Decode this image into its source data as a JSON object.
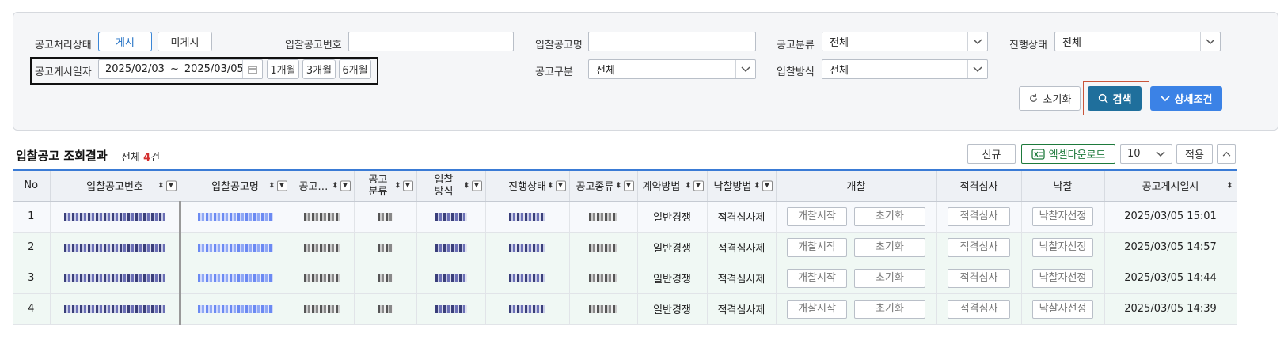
{
  "filters": {
    "status_label": "공고처리상태",
    "status_posted": "게시",
    "status_unposted": "미게시",
    "notice_no_label": "입찰공고번호",
    "notice_name_label": "입찰공고명",
    "category_label": "공고분류",
    "category_value": "전체",
    "progress_label": "진행상태",
    "progress_value": "전체",
    "post_date_label": "공고게시일자",
    "date_from": "2025/02/03",
    "date_sep": "~",
    "date_to": "2025/03/05",
    "range_1m": "1개월",
    "range_3m": "3개월",
    "range_6m": "6개월",
    "notice_type_label": "공고구분",
    "notice_type_value": "전체",
    "bid_method_label": "입찰방식",
    "bid_method_value": "전체",
    "reset_label": "초기화",
    "search_label": "검색",
    "detail_label": "상세조건"
  },
  "results": {
    "title": "입찰공고 조회결과",
    "total_prefix": "전체 ",
    "total_count": "4",
    "total_suffix": "건",
    "new_label": "신규",
    "excel_label": "엑셀다운로드",
    "page_size": "10",
    "apply_label": "적용"
  },
  "table": {
    "headers": {
      "no": "No",
      "notice_no": "입찰공고번호",
      "notice_name": "입찰공고명",
      "notice_trunc": "공고…",
      "cat_1": "공고",
      "cat_2": "분류",
      "bid_1": "입찰",
      "bid_2": "방식",
      "progress": "진행상태",
      "kind": "공고종류",
      "contract": "계약방법",
      "award": "낙찰방법",
      "opening": "개찰",
      "qual": "적격심사",
      "award_sel": "낙찰",
      "posted_at": "공고게시일시"
    },
    "rows": [
      {
        "no": "1",
        "contract": "일반경쟁",
        "award": "적격심사제",
        "open_start": "개찰시작",
        "reset": "초기화",
        "qual": "적격심사",
        "award_sel": "낙찰자선정",
        "posted_at": "2025/03/05 15:01"
      },
      {
        "no": "2",
        "contract": "일반경쟁",
        "award": "적격심사제",
        "open_start": "개찰시작",
        "reset": "초기화",
        "qual": "적격심사",
        "award_sel": "낙찰자선정",
        "posted_at": "2025/03/05 14:57"
      },
      {
        "no": "3",
        "contract": "일반경쟁",
        "award": "적격심사제",
        "open_start": "개찰시작",
        "reset": "초기화",
        "qual": "적격심사",
        "award_sel": "낙찰자선정",
        "posted_at": "2025/03/05 14:44"
      },
      {
        "no": "4",
        "contract": "일반경쟁",
        "award": "적격심사제",
        "open_start": "개찰시작",
        "reset": "초기화",
        "qual": "적격심사",
        "award_sel": "낙찰자선정",
        "posted_at": "2025/03/05 14:39"
      }
    ]
  },
  "colors": {
    "primary": "#1f6f9c",
    "detail": "#3b82e6",
    "excel_green": "#1e7a3c",
    "count_red": "#d32f2f"
  }
}
